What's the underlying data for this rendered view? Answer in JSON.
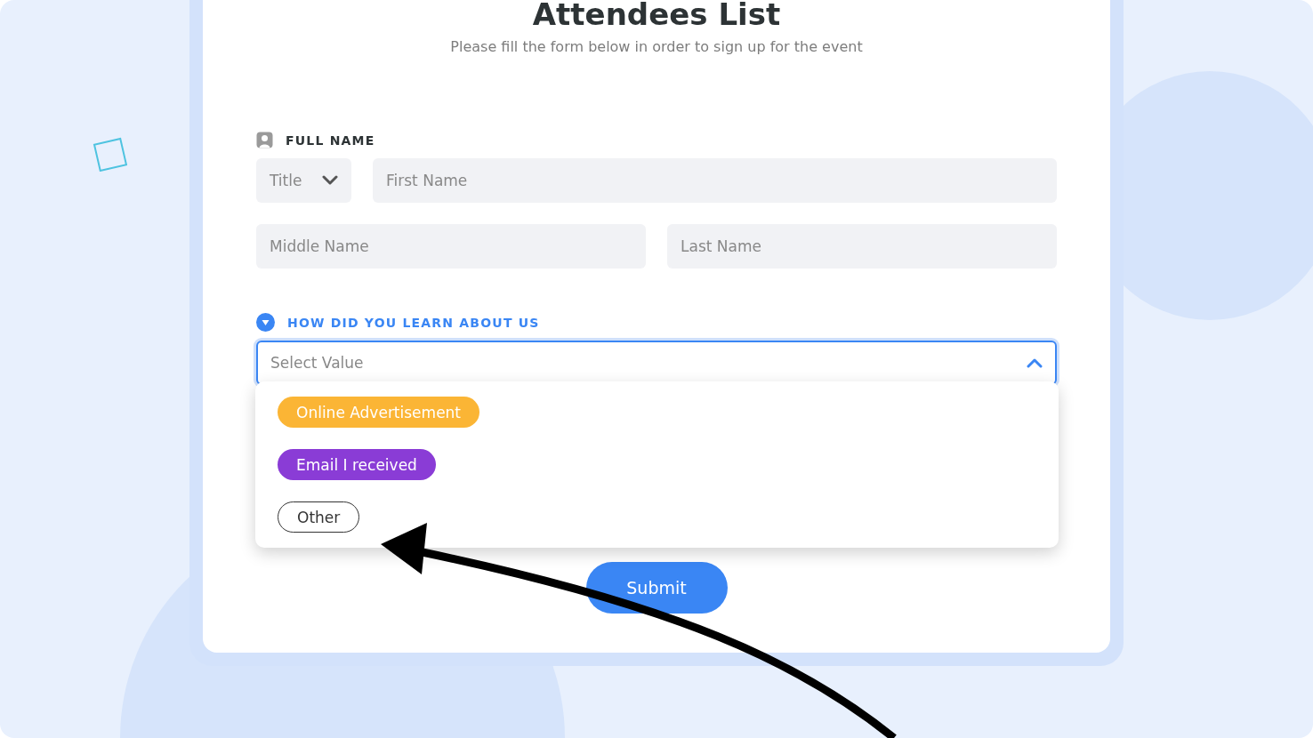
{
  "title": "Attendees List",
  "subtitle": "Please fill the form below in order to sign up for the event",
  "full_name": {
    "label": "FULL NAME",
    "title_select": {
      "value": "Title",
      "expanded": false
    },
    "fields": [
      {
        "placeholder": "First Name"
      },
      {
        "placeholder": "Middle Name"
      },
      {
        "placeholder": "Last Name"
      }
    ]
  },
  "source": {
    "label": "HOW DID YOU LEARN ABOUT US",
    "select": {
      "placeholder": "Select Value",
      "expanded": true
    },
    "options": [
      {
        "label": "Online Advertisement",
        "kind": "filled",
        "color": "#fbb535"
      },
      {
        "label": "Email I received",
        "kind": "filled",
        "color": "#8a3cd6"
      },
      {
        "label": "Other",
        "kind": "outline",
        "color": "#333333"
      }
    ]
  },
  "submit": {
    "label": "Submit"
  }
}
